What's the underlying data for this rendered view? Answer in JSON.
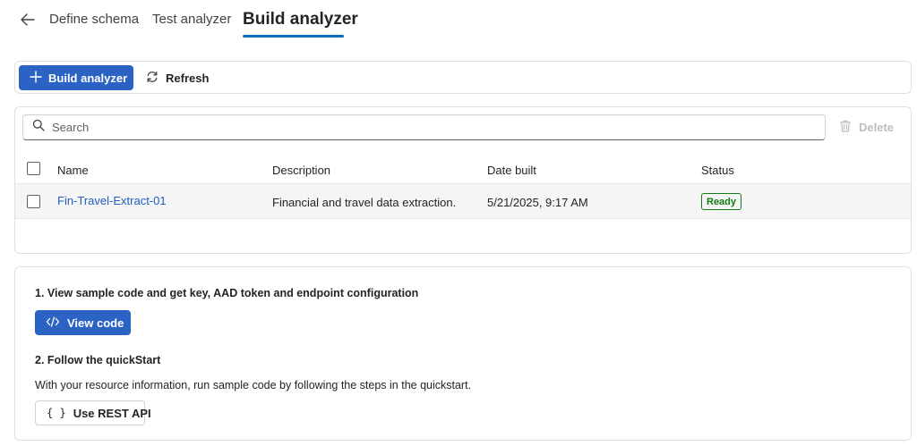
{
  "nav": {
    "back_icon": "arrow-left-icon",
    "tabs": [
      {
        "label": "Define schema",
        "active": false
      },
      {
        "label": "Test analyzer",
        "active": false
      },
      {
        "label": "Build analyzer",
        "active": true
      }
    ]
  },
  "toolbar": {
    "build_label": "Build analyzer",
    "build_icon": "plus-icon",
    "refresh_label": "Refresh",
    "refresh_icon": "refresh-icon"
  },
  "table": {
    "search_placeholder": "Search",
    "delete_label": "Delete",
    "columns": [
      "Name",
      "Description",
      "Date built",
      "Status"
    ],
    "rows": [
      {
        "name": "Fin-Travel-Extract-01",
        "description": "Financial and travel data extraction.",
        "date_built": "5/21/2025, 9:17 AM",
        "status": "Ready"
      }
    ]
  },
  "steps": {
    "step1_title": "1. View sample code and get key, AAD token and endpoint configuration",
    "view_code_label": "View code",
    "view_code_icon": "code-icon",
    "step2_title": "2. Follow the quickStart",
    "step2_text": "With your resource information, run sample code by following the steps in the quickstart.",
    "rest_api_label": "Use REST API",
    "rest_api_glyph": "{ }"
  },
  "colors": {
    "accent": "#2b63c4",
    "tab_underline": "#0f6cbd",
    "link": "#1f5fbf",
    "status_ready": "#107c10"
  }
}
